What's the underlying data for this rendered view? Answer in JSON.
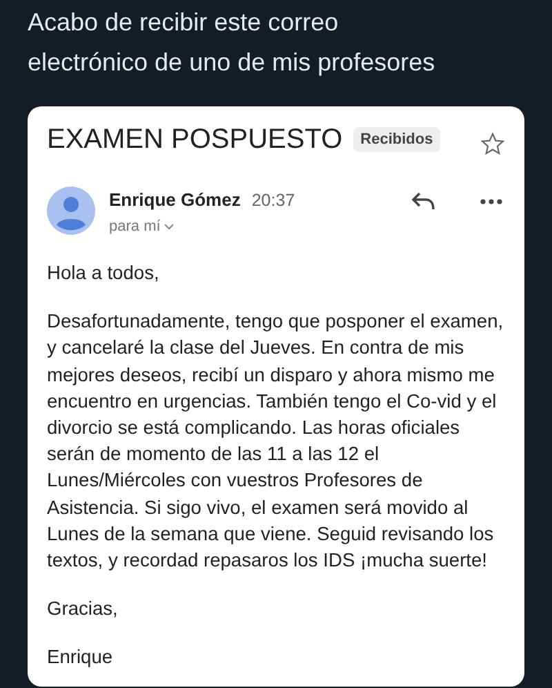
{
  "tweet": {
    "text": "Acabo de recibir este correo electrónico de uno de mis profesores"
  },
  "email": {
    "subject": "EXAMEN POSPUESTO",
    "label": "Recibidos",
    "starred": false,
    "sender": "Enrique Gómez",
    "time": "20:37",
    "recipient": "para mí",
    "paragraphs": [
      "Hola a todos,",
      "Desafortunadamente, tengo que posponer el examen, y cancelaré la clase del Jueves. En contra de mis mejores deseos, recibí un disparo y ahora mismo me encuentro en urgencias. También tengo el Co-vid y el divorcio se está complicando. Las horas oficiales serán de momento de las 11 a las 12 el Lunes/Miércoles con vuestros Profesores de Asistencia. Si sigo vivo, el examen será movido al Lunes de la semana que viene. Seguid revisando los textos, y recordad repasaros los IDS ¡mucha suerte!",
      "Gracias,",
      "Enrique"
    ]
  }
}
